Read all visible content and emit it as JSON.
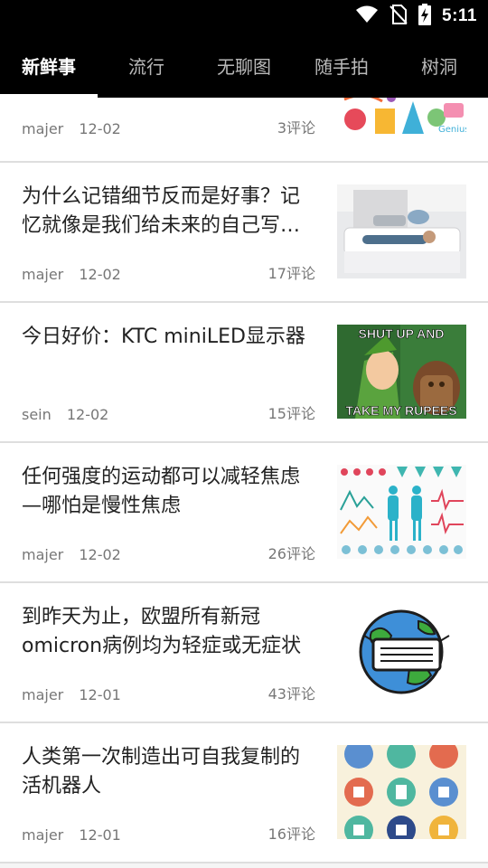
{
  "status": {
    "time": "5:11"
  },
  "tabs": [
    "新鲜事",
    "流行",
    "无聊图",
    "随手拍",
    "树洞"
  ],
  "items": [
    {
      "title": "",
      "author": "majer",
      "date": "12-02",
      "comments": "3评论",
      "thumb": "doodle-illustration"
    },
    {
      "title": "为什么记错细节反而是好事？记忆就像是我们给未来的自己写的信",
      "author": "majer",
      "date": "12-02",
      "comments": "17评论",
      "thumb": "woman-on-sofa-photo"
    },
    {
      "title": "今日好价：KTC miniLED显示器",
      "author": "sein",
      "date": "12-02",
      "comments": "15评论",
      "thumb": "meme-shut-up-and-take-my-rupees",
      "thumb_text_top": "SHUT UP AND",
      "thumb_text_bottom": "TAKE MY RUPEES"
    },
    {
      "title": "任何强度的运动都可以减轻焦虑—哪怕是慢性焦虑",
      "author": "majer",
      "date": "12-02",
      "comments": "26评论",
      "thumb": "health-infographic"
    },
    {
      "title": "到昨天为止，欧盟所有新冠omicron病例均为轻症或无症状",
      "author": "majer",
      "date": "12-01",
      "comments": "43评论",
      "thumb": "earth-with-mask"
    },
    {
      "title": "人类第一次制造出可自我复制的活机器人",
      "author": "majer",
      "date": "12-01",
      "comments": "16评论",
      "thumb": "energy-icons-grid"
    }
  ]
}
